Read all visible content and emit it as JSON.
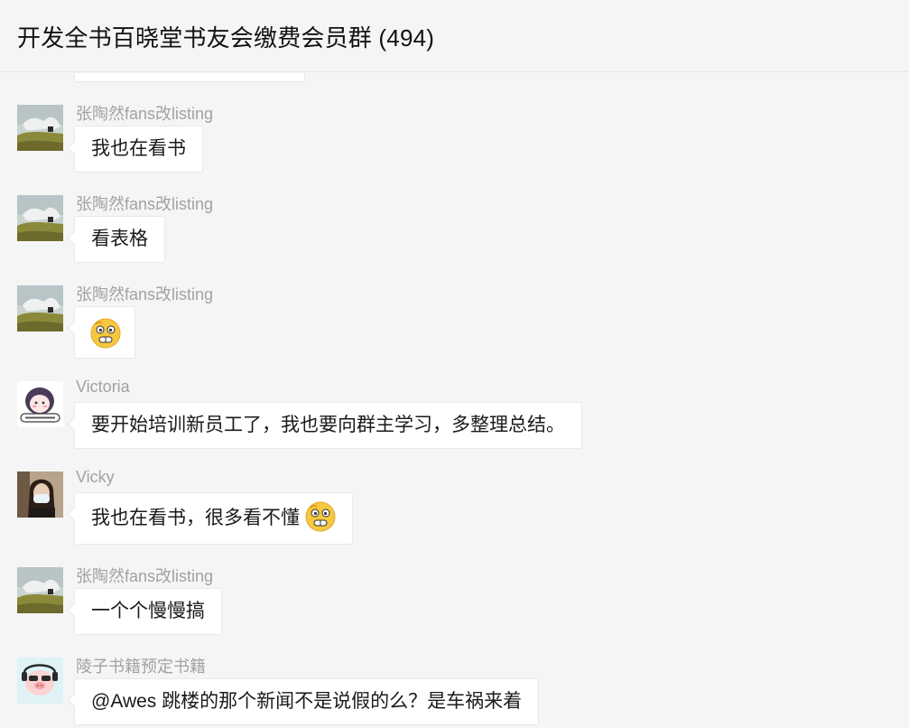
{
  "header": {
    "title": "开发全书百晓堂书友会缴费会员群 (494)"
  },
  "messages": [
    {
      "sender": "张陶然fans改listing",
      "avatar": "landscape-avatar",
      "text": "我也在看书"
    },
    {
      "sender": "张陶然fans改listing",
      "avatar": "landscape-avatar",
      "text": "看表格"
    },
    {
      "sender": "张陶然fans改listing",
      "avatar": "landscape-avatar",
      "text": "",
      "emoji": "grimace-emoji"
    },
    {
      "sender": "Victoria",
      "avatar": "cartoon-girl-avatar",
      "text": "要开始培训新员工了，我也要向群主学习，多整理总结。"
    },
    {
      "sender": "Vicky",
      "avatar": "masked-person-avatar",
      "text": "我也在看书，很多看不懂",
      "emoji": "grimace-emoji"
    },
    {
      "sender": "张陶然fans改listing",
      "avatar": "landscape-avatar",
      "text": "一个个慢慢搞"
    },
    {
      "sender": "陵子书籍预定书籍",
      "avatar": "cartoon-pig-avatar",
      "text": "@Awes 跳楼的那个新闻不是说假的么？是车祸来着"
    }
  ]
}
